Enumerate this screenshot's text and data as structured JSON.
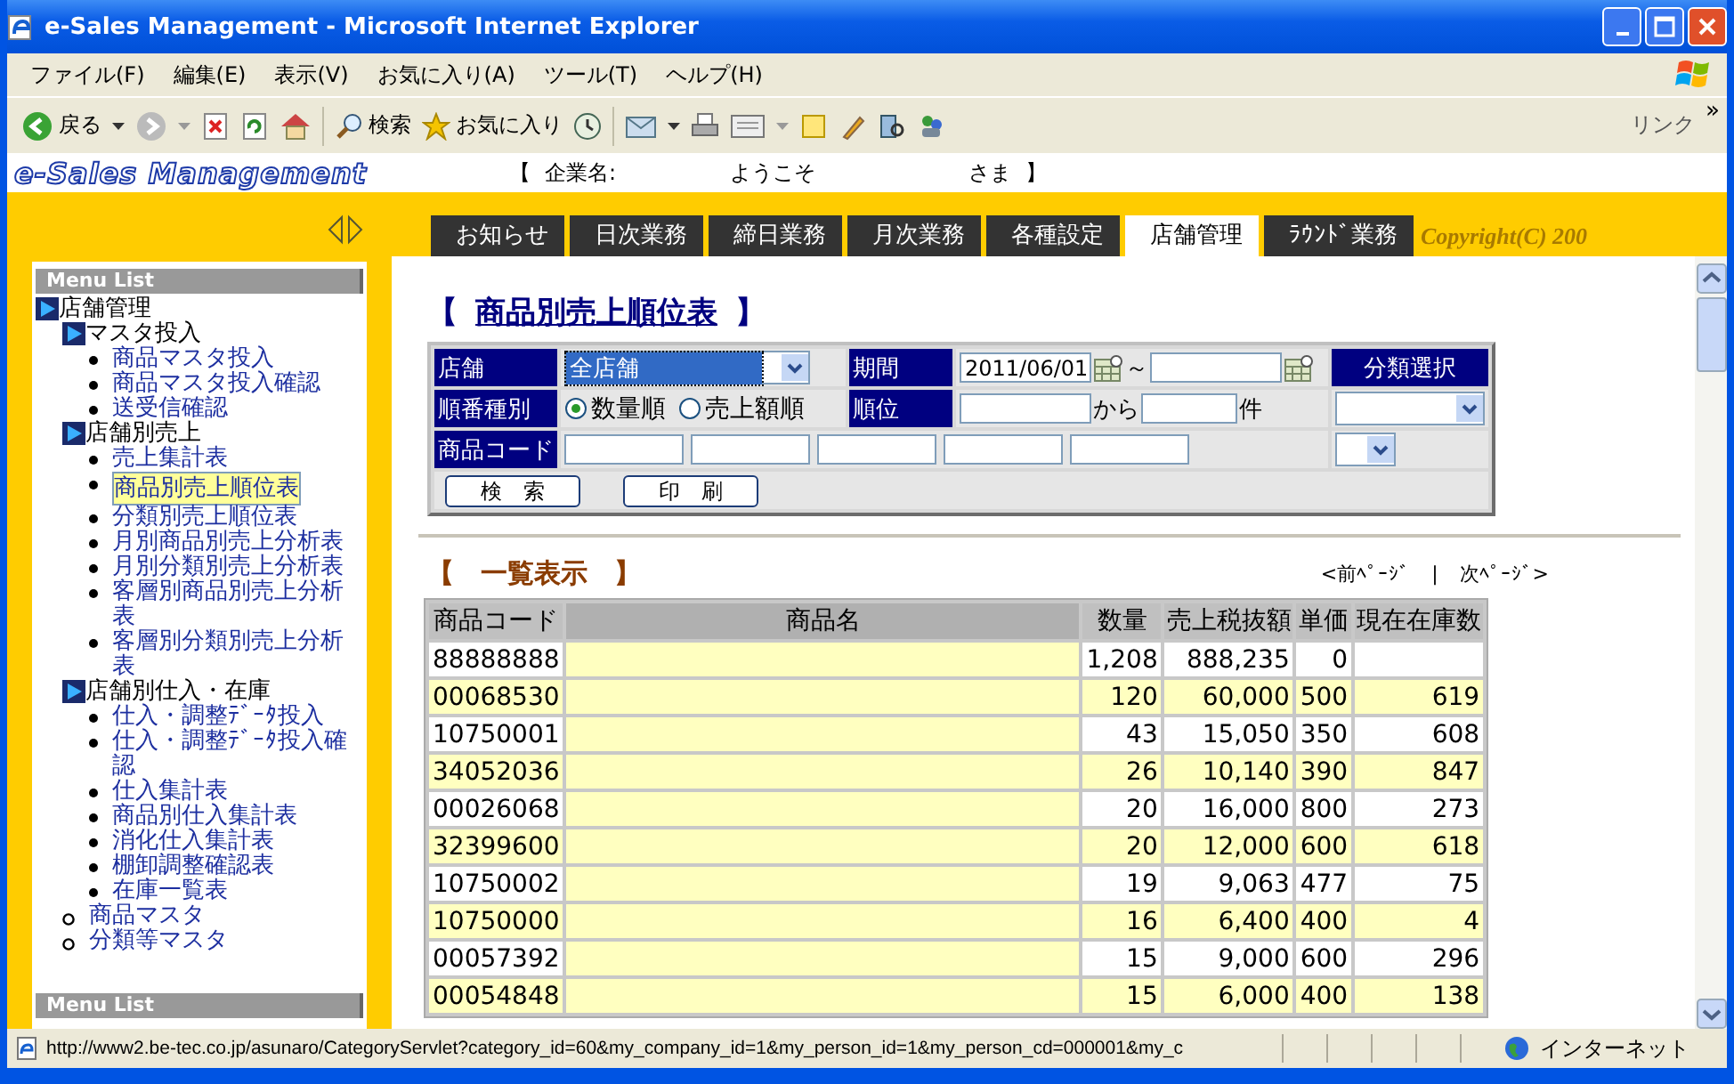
{
  "window": {
    "title": "e-Sales Management - Microsoft Internet Explorer"
  },
  "menu_bar": [
    "ファイル(F)",
    "編集(E)",
    "表示(V)",
    "お気に入り(A)",
    "ツール(T)",
    "ヘルプ(H)"
  ],
  "toolbar": {
    "back": "戻る",
    "search": "検索",
    "favorites": "お気に入り",
    "links": "リンク",
    "more": "»"
  },
  "header": {
    "logo": "e-Sales Management",
    "company_open": "【",
    "company_label": "企業名:",
    "welcome": "ようこそ",
    "honorific": "さま",
    "company_close": "】"
  },
  "tabs": [
    {
      "label": "お知らせ",
      "selected": false
    },
    {
      "label": "日次業務",
      "selected": false
    },
    {
      "label": "締日業務",
      "selected": false
    },
    {
      "label": "月次業務",
      "selected": false
    },
    {
      "label": "各種設定",
      "selected": false
    },
    {
      "label": "店舗管理",
      "selected": true
    },
    {
      "label": "ﾗｳﾝﾄﾞ業務",
      "selected": false
    }
  ],
  "copyright": "Copyright(C) 200",
  "sidebar": {
    "title": "Menu List",
    "footer_title": "Menu List",
    "items": [
      {
        "label": "店舗管理",
        "kind": "folder",
        "selected": false,
        "children": [
          {
            "label": "マスタ投入",
            "kind": "folder",
            "selected": false,
            "children": [
              {
                "label": "商品マスタ投入",
                "kind": "link",
                "selected": false
              },
              {
                "label": "商品マスタ投入確認",
                "kind": "link",
                "selected": false
              },
              {
                "label": "送受信確認",
                "kind": "link",
                "selected": false
              }
            ]
          },
          {
            "label": "店舗別売上",
            "kind": "folder",
            "selected": false,
            "children": [
              {
                "label": "売上集計表",
                "kind": "link",
                "selected": false
              },
              {
                "label": "商品別売上順位表",
                "kind": "link",
                "selected": true
              },
              {
                "label": "分類別売上順位表",
                "kind": "link",
                "selected": false
              },
              {
                "label": "月別商品別売上分析表",
                "kind": "link",
                "selected": false
              },
              {
                "label": "月別分類別売上分析表",
                "kind": "link",
                "selected": false
              },
              {
                "label": "客層別商品別売上分析表",
                "kind": "link",
                "selected": false
              },
              {
                "label": "客層別分類別売上分析表",
                "kind": "link",
                "selected": false
              }
            ]
          },
          {
            "label": "店舗別仕入・在庫",
            "kind": "folder",
            "selected": false,
            "children": [
              {
                "label": "仕入・調整ﾃﾞｰﾀ投入",
                "kind": "link",
                "selected": false
              },
              {
                "label": "仕入・調整ﾃﾞｰﾀ投入確認",
                "kind": "link",
                "selected": false
              },
              {
                "label": "仕入集計表",
                "kind": "link",
                "selected": false
              },
              {
                "label": "商品別仕入集計表",
                "kind": "link",
                "selected": false
              },
              {
                "label": "消化仕入集計表",
                "kind": "link",
                "selected": false
              },
              {
                "label": "棚卸調整確認表",
                "kind": "link",
                "selected": false
              },
              {
                "label": "在庫一覧表",
                "kind": "link",
                "selected": false
              }
            ]
          },
          {
            "label": "商品マスタ",
            "kind": "circle",
            "selected": false
          },
          {
            "label": "分類等マスタ",
            "kind": "circle",
            "selected": false
          }
        ]
      }
    ]
  },
  "page_title": {
    "open": "【",
    "text": "商品別売上順位表",
    "close": "】"
  },
  "form": {
    "store_label": "店舗",
    "store_value": "全店舗",
    "store_focused": true,
    "period_label": "期間",
    "period_from": "2011/06/01",
    "period_sep": "～",
    "category_label": "分類選択",
    "order_label": "順番種別",
    "order_options": [
      {
        "label": "数量順",
        "selected": true
      },
      {
        "label": "売上額順",
        "selected": false
      }
    ],
    "rank_label": "順位",
    "rank_from": "から",
    "rank_unit": "件",
    "code_label": "商品コード",
    "buttons": [
      "検　索",
      "印　刷"
    ]
  },
  "list": {
    "title": "【　一覧表示　】",
    "prev": "<前ﾍﾟｰｼﾞ",
    "separator": "|",
    "next": "次ﾍﾟｰｼﾞ>",
    "columns": [
      "商品コード",
      "商品名",
      "数量",
      "売上税抜額",
      "単価",
      "現在在庫数"
    ],
    "rows": [
      {
        "code": "88888888",
        "quantity": "1,208",
        "sales": "888,235",
        "price": "0",
        "shaded": false
      },
      {
        "code": "00068530",
        "quantity": "120",
        "sales": "60,000",
        "price": "500",
        "stock": "619",
        "shaded": true
      },
      {
        "code": "10750001",
        "quantity": "43",
        "sales": "15,050",
        "price": "350",
        "stock": "608",
        "shaded": false
      },
      {
        "code": "34052036",
        "quantity": "26",
        "sales": "10,140",
        "price": "390",
        "stock": "847",
        "shaded": true
      },
      {
        "code": "00026068",
        "quantity": "20",
        "sales": "16,000",
        "price": "800",
        "stock": "273",
        "shaded": false
      },
      {
        "code": "32399600",
        "quantity": "20",
        "sales": "12,000",
        "price": "600",
        "stock": "618",
        "shaded": true
      },
      {
        "code": "10750002",
        "quantity": "19",
        "sales": "9,063",
        "price": "477",
        "stock": "75",
        "shaded": false
      },
      {
        "code": "10750000",
        "quantity": "16",
        "sales": "6,400",
        "price": "400",
        "stock": "4",
        "shaded": true
      },
      {
        "code": "00057392",
        "quantity": "15",
        "sales": "9,000",
        "price": "600",
        "stock": "296",
        "shaded": false
      },
      {
        "code": "00054848",
        "quantity": "15",
        "sales": "6,000",
        "price": "400",
        "stock": "138",
        "shaded": true
      }
    ]
  },
  "status_bar": {
    "url": "http://www2.be-tec.co.jp/asunaro/CategoryServlet?category_id=60&my_company_id=1&my_person_id=1&my_person_cd=000001&my_c",
    "zone": "インターネット"
  }
}
